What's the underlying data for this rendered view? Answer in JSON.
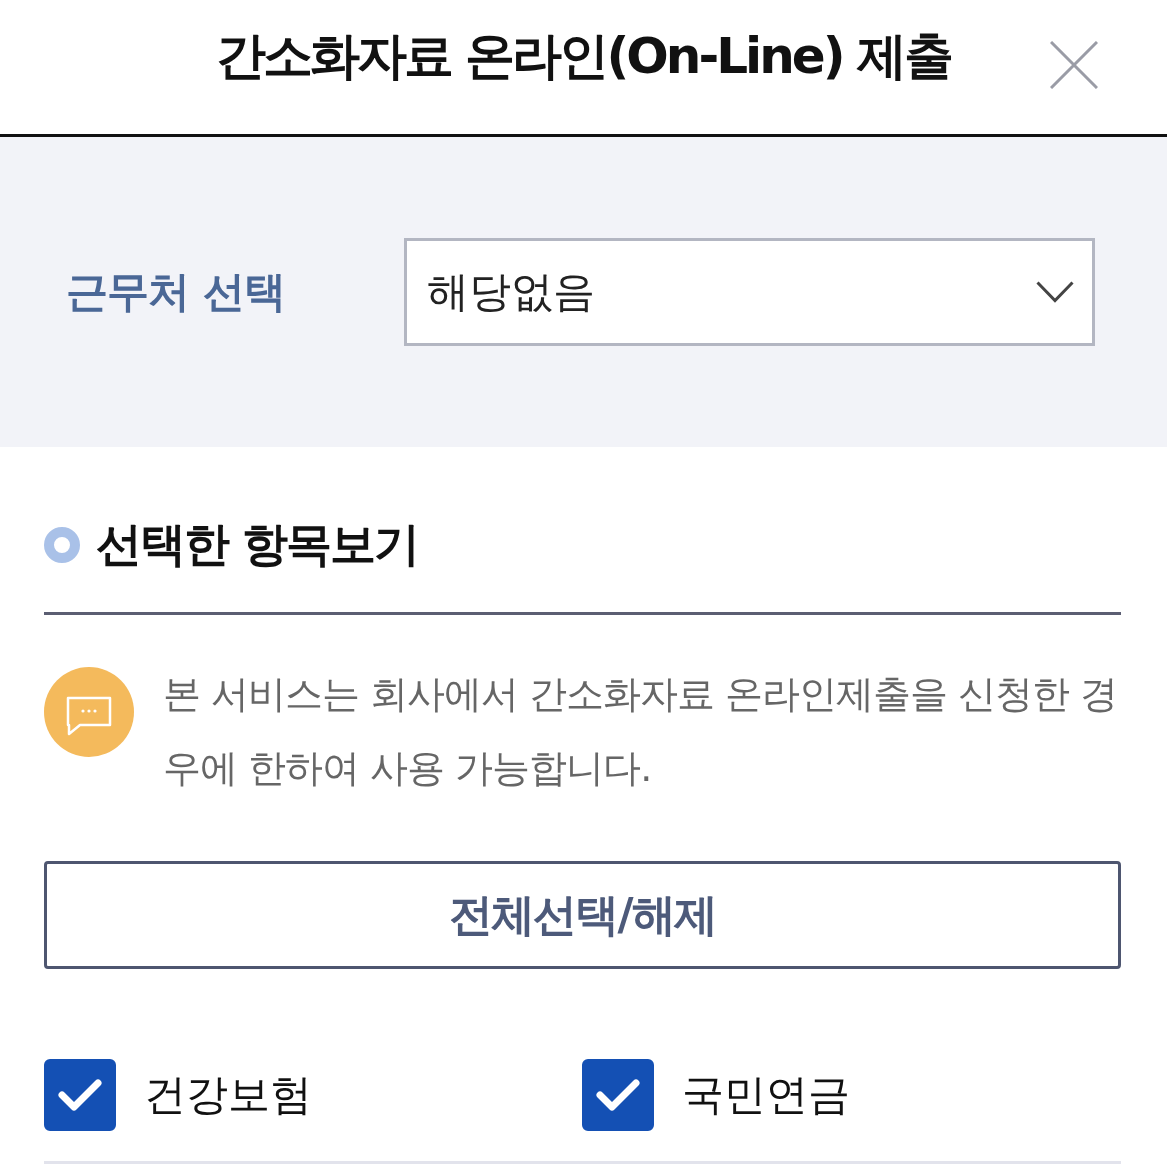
{
  "header": {
    "title": "간소화자료 온라인(On-Line) 제출"
  },
  "workplace": {
    "label": "근무처 선택",
    "select": {
      "value": "해당없음"
    }
  },
  "section": {
    "title": "선택한 항목보기"
  },
  "notice": {
    "text": "본 서비스는 회사에서 간소화자료 온라인제출을 신청한 경우에 한하여 사용 가능합니다."
  },
  "select_all_button": {
    "label": "전체선택/해제"
  },
  "items": [
    {
      "label": "건강보험",
      "checked": true
    },
    {
      "label": "국민연금",
      "checked": true
    }
  ]
}
